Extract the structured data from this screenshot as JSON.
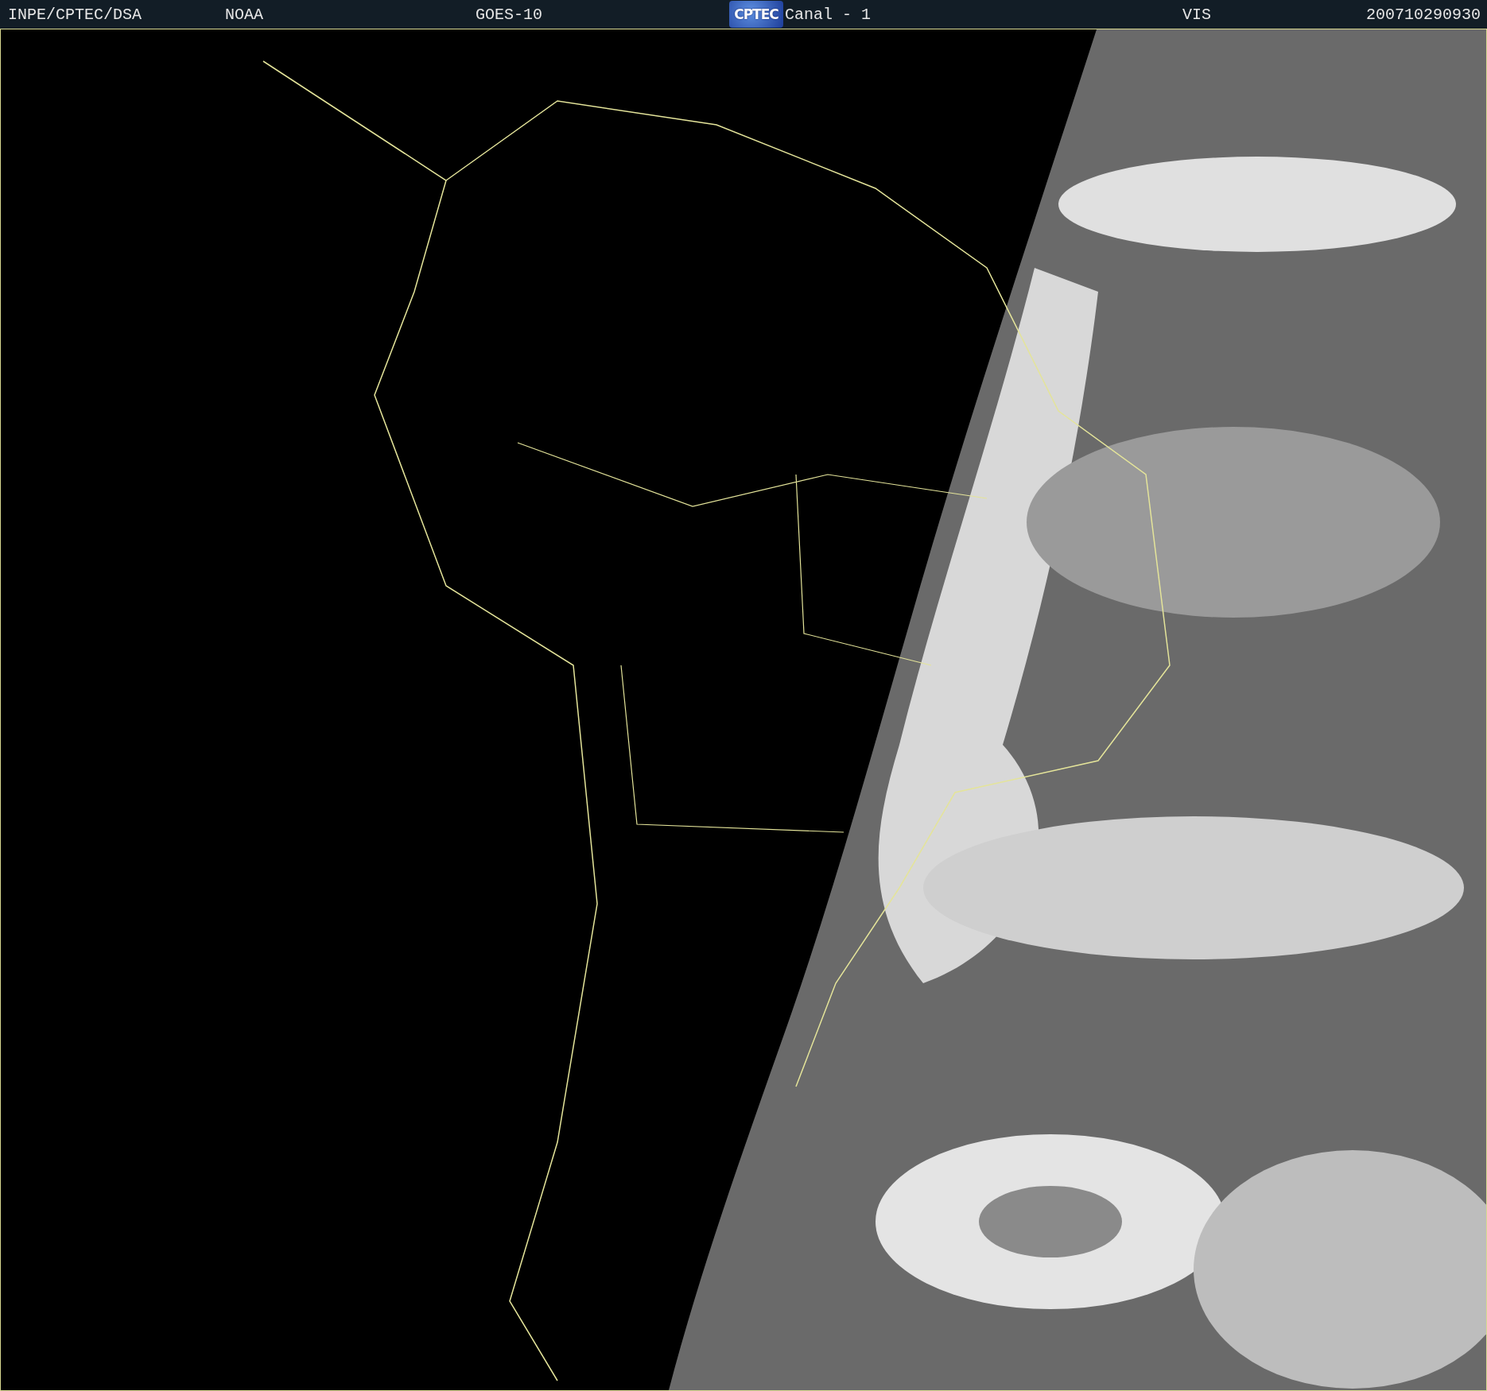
{
  "header": {
    "items": [
      {
        "kind": "text",
        "text": "INPE/CPTEC/DSA"
      },
      {
        "kind": "text",
        "text": "NOAA"
      },
      {
        "kind": "text",
        "text": "GOES-10"
      },
      {
        "kind": "logo",
        "text": "CPTEC"
      },
      {
        "kind": "text",
        "text": "Canal - 1"
      },
      {
        "kind": "text",
        "text": "VIS"
      },
      {
        "kind": "text",
        "text": "200710290930"
      }
    ]
  }
}
